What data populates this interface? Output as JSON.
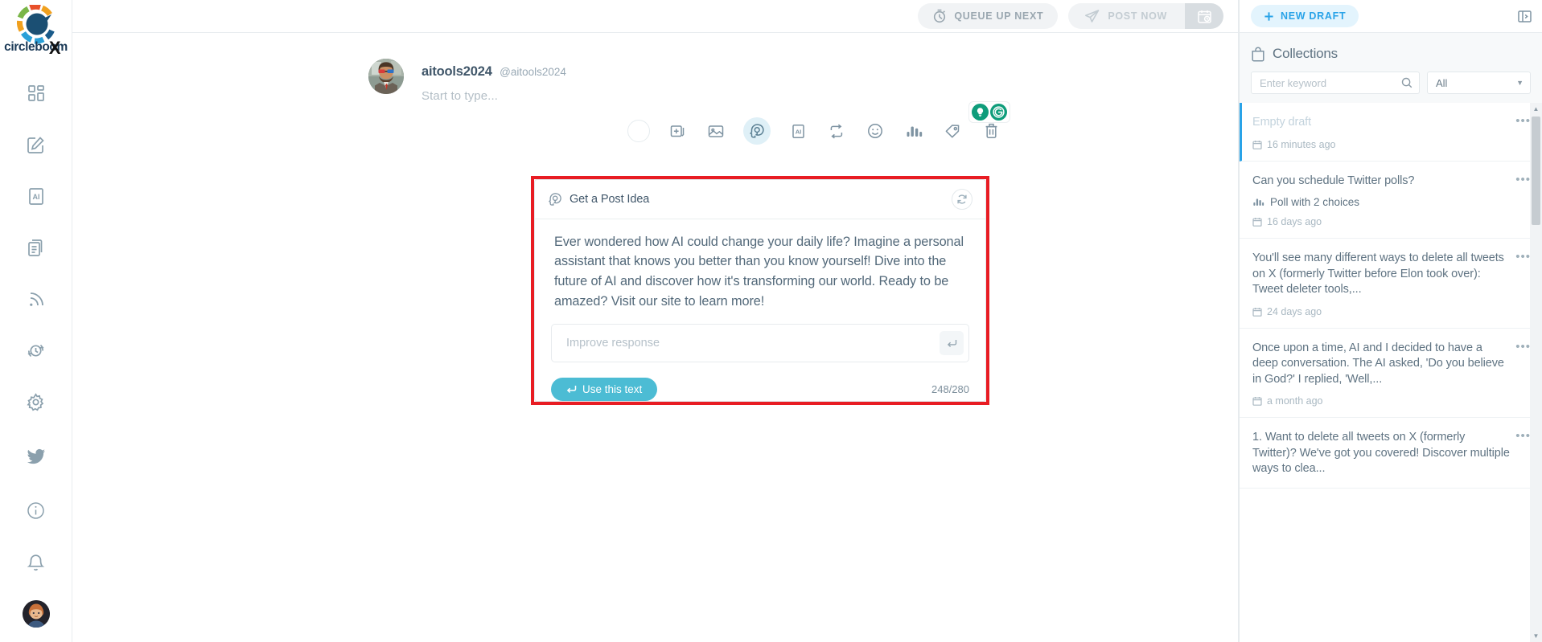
{
  "brand": {
    "name": "circleboom",
    "x_mark": "X"
  },
  "rail": {
    "items": [
      {
        "name": "dashboard",
        "icon": "grid-icon"
      },
      {
        "name": "compose",
        "icon": "pencil-square-icon"
      },
      {
        "name": "ai",
        "icon": "ai-document-icon"
      },
      {
        "name": "library",
        "icon": "copy-documents-icon"
      },
      {
        "name": "rss",
        "icon": "rss-icon"
      },
      {
        "name": "schedule",
        "icon": "clock-refresh-icon"
      },
      {
        "name": "settings",
        "icon": "gear-icon"
      }
    ],
    "bottom": [
      {
        "name": "twitter",
        "icon": "twitter-bird-icon"
      },
      {
        "name": "info",
        "icon": "info-circle-icon"
      },
      {
        "name": "notifications",
        "icon": "bell-icon"
      },
      {
        "name": "account",
        "icon": "avatar"
      }
    ]
  },
  "toolbar": {
    "queue_label": "QUEUE UP NEXT",
    "post_label": "POST NOW",
    "queue_icon": "stopwatch-icon",
    "post_icon": "paper-plane-icon",
    "schedule_icon": "calendar-clock-icon"
  },
  "composer": {
    "account_name": "aitools2024",
    "account_handle": "@aitools2024",
    "placeholder": "Start to type...",
    "badges": [
      {
        "name": "idea-bulb",
        "icon": "lightbulb-icon",
        "color": "#0f9d7b"
      },
      {
        "name": "grammarly",
        "icon": "grammarly-g-icon",
        "color": "#0f9d7b"
      }
    ],
    "tools": [
      {
        "name": "char-counter",
        "icon": "circle-icon"
      },
      {
        "name": "add-post",
        "icon": "add-post-icon"
      },
      {
        "name": "add-image",
        "icon": "image-icon"
      },
      {
        "name": "ai-post-idea",
        "icon": "ai-head-icon",
        "active": true
      },
      {
        "name": "ai-text",
        "icon": "ai-box-icon"
      },
      {
        "name": "retweet",
        "icon": "repost-icon"
      },
      {
        "name": "emoji",
        "icon": "emoji-icon"
      },
      {
        "name": "poll",
        "icon": "poll-bars-icon"
      },
      {
        "name": "tag",
        "icon": "tag-icon"
      },
      {
        "name": "delete",
        "icon": "trash-icon"
      }
    ]
  },
  "ai_card": {
    "title": "Get a Post Idea",
    "title_icon": "ai-head-icon",
    "refresh_icon": "refresh-icon",
    "generated_text": "Ever wondered how AI could change your daily life? Imagine a personal assistant that knows you better than you know yourself! Dive into the future of AI and discover how it's transforming our world. Ready to be amazed? Visit our site to learn more!",
    "improve_placeholder": "Improve response",
    "improve_value": "",
    "enter_icon": "enter-key-icon",
    "use_label": "Use this text",
    "use_icon": "enter-key-icon",
    "counter": "248/280",
    "highlight_color": "#e81c23",
    "accent_color": "#4cbcd4"
  },
  "right_panel": {
    "new_draft_label": "NEW DRAFT",
    "new_draft_icon": "plus-icon",
    "panel_toggle_icon": "panel-collapse-icon",
    "collections_title": "Collections",
    "collections_icon": "bag-icon",
    "search_placeholder": "Enter keyword",
    "search_value": "",
    "search_icon": "search-icon",
    "filter_value": "All",
    "filter_options": [
      "All"
    ],
    "accent_color": "#29a3e8",
    "drafts": [
      {
        "title": "Empty draft",
        "time": "16 minutes ago",
        "selected": true,
        "poll": ""
      },
      {
        "title": "Can you schedule Twitter polls?",
        "time": "16 days ago",
        "selected": false,
        "poll": "Poll with 2 choices"
      },
      {
        "title": "You'll see many different ways to delete all tweets on X (formerly Twitter before Elon took over): Tweet deleter tools,...",
        "time": "24 days ago",
        "selected": false,
        "poll": ""
      },
      {
        "title": "Once upon a time, AI and I decided to have a deep conversation. The AI asked, 'Do you believe in God?' I replied, 'Well,...",
        "time": "a month ago",
        "selected": false,
        "poll": ""
      },
      {
        "title": "1. Want to delete all tweets on X (formerly Twitter)? We've got you covered! Discover multiple ways to clea...",
        "time": "",
        "selected": false,
        "poll": ""
      }
    ]
  }
}
